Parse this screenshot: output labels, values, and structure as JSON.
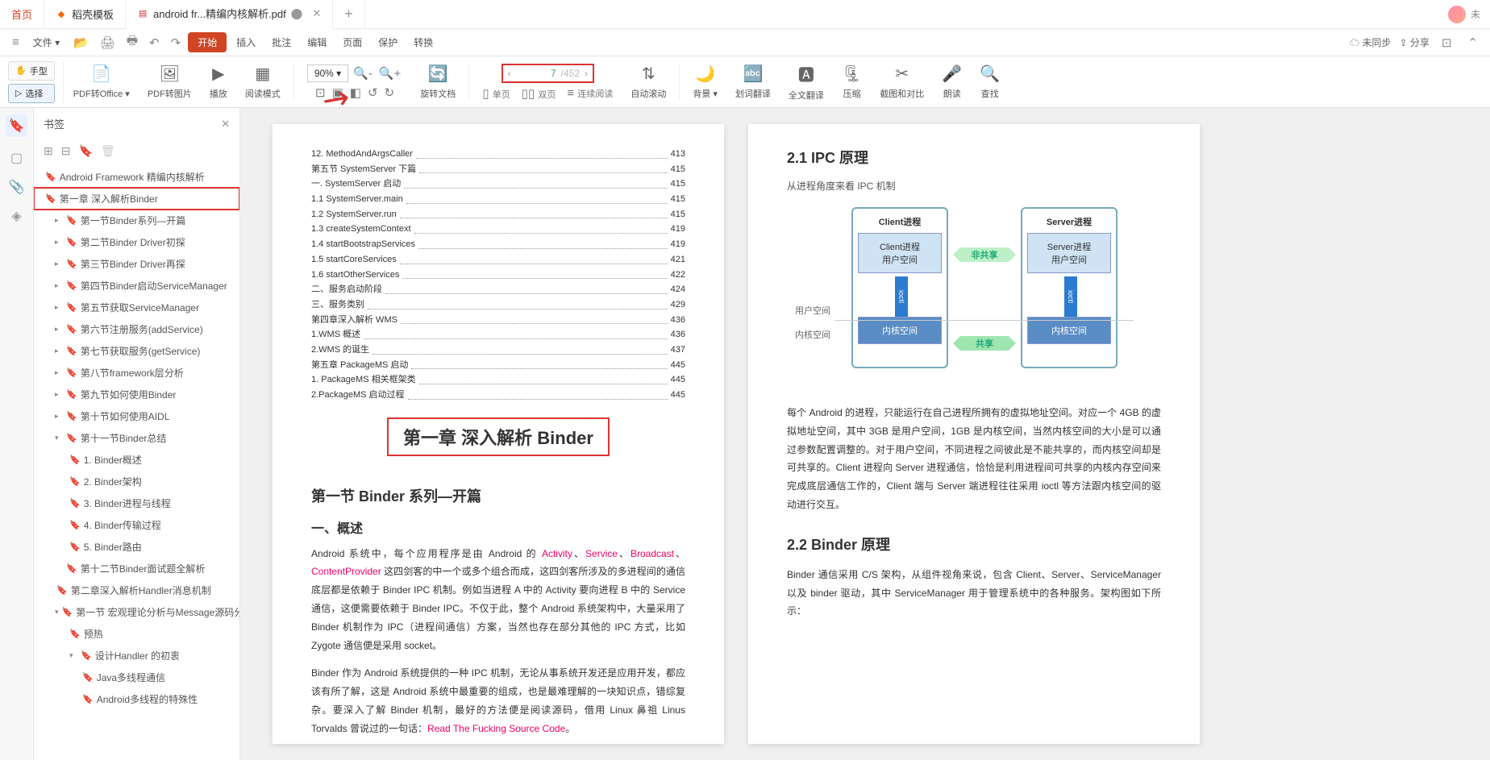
{
  "titlebar": {
    "home": "首页",
    "tab_templates": "稻壳模板",
    "tab_active": "android fr...精编内核解析.pdf",
    "user": "未"
  },
  "menubar": {
    "file": "文件",
    "start": "开始",
    "insert": "插入",
    "review": "批注",
    "edit": "编辑",
    "page": "页面",
    "protect": "保护",
    "convert": "转换",
    "unsync": "未同步",
    "share": "分享"
  },
  "toolbar": {
    "hand": "手型",
    "select": "选择",
    "pdf_office": "PDF转Office",
    "pdf_img": "PDF转图片",
    "play": "播放",
    "read_mode": "阅读模式",
    "zoom": "90%",
    "rotate": "旋转文档",
    "single": "单页",
    "double": "双页",
    "continuous": "连续阅读",
    "autoscroll": "自动滚动",
    "bg": "背景",
    "sel_trans": "划词翻译",
    "full_trans": "全文翻译",
    "compress": "压缩",
    "crop": "截图和对比",
    "read_aloud": "朗读",
    "find": "查找",
    "page_current": "7",
    "page_total": "/452"
  },
  "sidebar": {
    "title": "书签",
    "root": "Android Framework 精编内核解析",
    "ch1": "第一章 深入解析Binder",
    "items": [
      "第一节Binder系列—开篇",
      "第二节Binder Driver初探",
      "第三节Binder Driver再探",
      "第四节Binder启动ServiceManager",
      "第五节获取ServiceManager",
      "第六节注册服务(addService)",
      "第七节获取服务(getService)",
      "第八节framework层分析",
      "第九节如何使用Binder",
      "第十节如何使用AIDL"
    ],
    "s11": "第十一节Binder总结",
    "s11_items": [
      "1. Binder概述",
      "2. Binder架构",
      "3. Binder进程与线程",
      "4. Binder传输过程",
      "5. Binder路由"
    ],
    "s12": "第十二节Binder面试题全解析",
    "ch2": "第二章深入解析Handler消息机制",
    "c2s1": "第一节 宏观理论分析与Message源码分析",
    "c2s1_1": "预热",
    "c2s1_2": "设计Handler 的初衷",
    "c2s1_2a": "Java多线程通信",
    "c2s1_2b": "Android多线程的特殊性"
  },
  "page1": {
    "toc": [
      {
        "t": "12. MethodAndArgsCaller",
        "p": "413"
      },
      {
        "t": "第五节 SystemServer 下篇",
        "p": "415"
      },
      {
        "t": "一. SystemServer 启动",
        "p": "415"
      },
      {
        "t": "1.1 SystemServer.main",
        "p": "415"
      },
      {
        "t": "1.2 SystemServer.run",
        "p": "415"
      },
      {
        "t": "1.3 createSystemContext",
        "p": "419"
      },
      {
        "t": "1.4 startBootstrapServices",
        "p": "419"
      },
      {
        "t": "1.5 startCoreServices",
        "p": "421"
      },
      {
        "t": "1.6 startOtherServices",
        "p": "422"
      },
      {
        "t": "二、服务启动阶段",
        "p": "424"
      },
      {
        "t": "三、服务类别",
        "p": "429"
      },
      {
        "t": "第四章深入解析 WMS",
        "p": "436"
      },
      {
        "t": "1.WMS 概述",
        "p": "436"
      },
      {
        "t": "2.WMS 的诞生",
        "p": "437"
      },
      {
        "t": "第五章 PackageMS 启动",
        "p": "445"
      },
      {
        "t": "1. PackageMS 相关框架类",
        "p": "445"
      },
      {
        "t": "2.PackageMS 启动过程",
        "p": "445"
      }
    ],
    "ch_title": "第一章  深入解析 Binder",
    "sec_title": "第一节 Binder 系列—开篇",
    "sub_title": "一、概述",
    "para1a": "Android 系统中，每个应用程序是由 Android 的 ",
    "kw1": "Activity",
    "kw2": "Service",
    "kw3": "Broadcast",
    "kw4": "ContentProvider",
    "para1b": " 这四剑客的中一个或多个组合而成，这四剑客所涉及的多进程间的通信底层都是依赖于 Binder IPC 机制。例如当进程 A 中的 Activity 要向进程 B 中的 Service 通信，这便需要依赖于 Binder IPC。不仅于此，整个 Android 系统架构中，大量采用了 Binder 机制作为 IPC（进程间通信）方案，当然也存在部分其他的 IPC 方式，比如 Zygote 通信便是采用 socket。",
    "para2a": "Binder 作为 Android 系统提供的一种 IPC 机制，无论从事系统开发还是应用开发，都应该有所了解，这是 Android 系统中最重要的组成，也是最难理解的一块知识点，错综复杂。要深入了解 Binder 机制，最好的方法便是阅读源码，借用 Linux 鼻祖 Linus Torvalds 曾说过的一句话：",
    "kw5": "Read The Fucking Source Code"
  },
  "page2": {
    "h21": "2.1 IPC 原理",
    "desc1": "从进程角度来看 IPC 机制",
    "diag": {
      "client": "Client进程",
      "server": "Server进程",
      "client_user": "Client进程\n用户空间",
      "server_user": "Server进程\n用户空间",
      "kernel": "内核空间",
      "user_label": "用户空间",
      "kernel_label": "内核空间",
      "noshare": "非共享",
      "share": "共享",
      "ioctl": "ioctl"
    },
    "para1": "每个 Android 的进程，只能运行在自己进程所拥有的虚拟地址空间。对应一个 4GB 的虚拟地址空间，其中 3GB 是用户空间，1GB 是内核空间，当然内核空间的大小是可以通过参数配置调整的。对于用户空间，不同进程之间彼此是不能共享的，而内核空间却是可共享的。Client 进程向 Server 进程通信，恰恰是利用进程间可共享的内核内存空间来完成底层通信工作的，Client 端与 Server 端进程往往采用 ioctl 等方法跟内核空间的驱动进行交互。",
    "h22": "2.2 Binder 原理",
    "para2": "Binder 通信采用 C/S 架构，从组件视角来说，包含 Client、Server、ServiceManager 以及 binder 驱动，其中 ServiceManager 用于管理系统中的各种服务。架构图如下所示："
  }
}
